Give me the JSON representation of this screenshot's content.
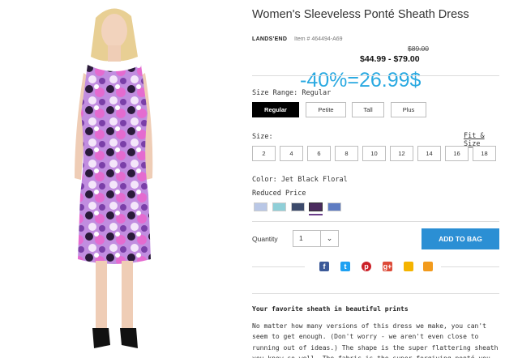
{
  "product": {
    "title": "Women's Sleeveless Ponté Sheath Dress",
    "brand": "LANDS'END",
    "item_number": "Item # 464494-A69",
    "original_price": "$89.00",
    "price_range": "$44.99 - $79.00",
    "promo_overlay": "-40%=26.99$"
  },
  "size_range": {
    "label": "Size Range: Regular",
    "options": [
      "Regular",
      "Petite",
      "Tall",
      "Plus"
    ],
    "selected": "Regular"
  },
  "size": {
    "label": "Size:",
    "fit_link": "Fit & Size",
    "options": [
      "2",
      "4",
      "6",
      "8",
      "10",
      "12",
      "14",
      "16",
      "18"
    ]
  },
  "color": {
    "label": "Color: Jet Black Floral",
    "sublabel": "Reduced Price",
    "swatches": [
      {
        "name": "light-blue-floral",
        "color": "#b9c7e6"
      },
      {
        "name": "aqua-floral",
        "color": "#8fcfd8"
      },
      {
        "name": "navy-floral",
        "color": "#3c4a6b"
      },
      {
        "name": "jet-black-floral",
        "color": "#4b2b5e"
      },
      {
        "name": "blue-floral",
        "color": "#5f7cc2"
      }
    ],
    "selected_index": 3
  },
  "quantity": {
    "label": "Quantity",
    "value": "1"
  },
  "cart": {
    "add_label": "ADD TO BAG",
    "accent": "#2b8fd4"
  },
  "share": [
    {
      "name": "facebook-icon",
      "glyph": "f",
      "color": "#3b5998"
    },
    {
      "name": "twitter-icon",
      "glyph": "t",
      "color": "#1da1f2"
    },
    {
      "name": "pinterest-icon",
      "glyph": "p",
      "color": "#cb2027"
    },
    {
      "name": "google-plus-icon",
      "glyph": "g+",
      "color": "#dd4b39"
    },
    {
      "name": "polyvore-icon",
      "glyph": "",
      "color": "#f5b400"
    },
    {
      "name": "email-icon",
      "glyph": "",
      "color": "#f29b1d"
    }
  ],
  "description": {
    "heading": "Your favorite sheath in beautiful prints",
    "body": "No matter how many versions of this dress we make, you can't seem to get enough. (Don't worry - we aren't even close to running out of ideas.) The shape is the super flattering sheath you know so well. The fabric is the super forgiving ponté you love. And"
  }
}
